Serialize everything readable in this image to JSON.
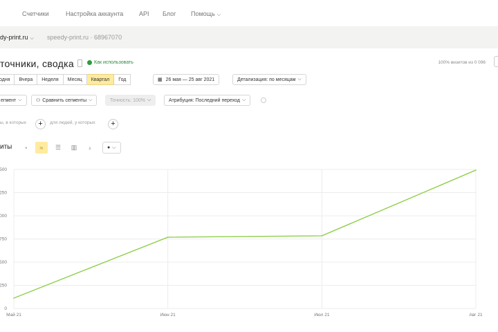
{
  "topnav": {
    "items": [
      "Счетчики",
      "Настройка аккаунта",
      "API",
      "Блог",
      "Помощь"
    ]
  },
  "site": {
    "current": "dy-print.ru",
    "counter": "speedy-print.ru · 68967070"
  },
  "header": {
    "title": "точники, сводка",
    "howto": "Как использовать",
    "visits": "100% визитов из 0 096"
  },
  "periods": {
    "items": [
      "одня",
      "Вчера",
      "Неделя",
      "Месяц",
      "Квартал",
      "Год"
    ],
    "active": 4
  },
  "date_range": "26 мая — 25 авг 2021",
  "detail": "Детализация: по месяцам",
  "segment": "егмент",
  "compare": "Сравнить сегменты",
  "accuracy": "Точность: 100%",
  "attribution": "Атрибуция: Последний переход",
  "filters": {
    "left": "ы, в которых",
    "right": "для людей, у которых"
  },
  "metrics_label": "иты",
  "chart_data": {
    "type": "line",
    "categories": [
      "Май 21",
      "Июн 21",
      "Июл 21",
      "Авг 21"
    ],
    "series": [
      {
        "name": "Визиты",
        "values": [
          112,
          769,
          784,
          1493
        ],
        "color": "#8fcf4a"
      }
    ],
    "y_ticks": [
      "0",
      "250",
      "500",
      "750",
      "000",
      "250",
      "500"
    ],
    "ylim": [
      0,
      1500
    ],
    "grid": true
  }
}
